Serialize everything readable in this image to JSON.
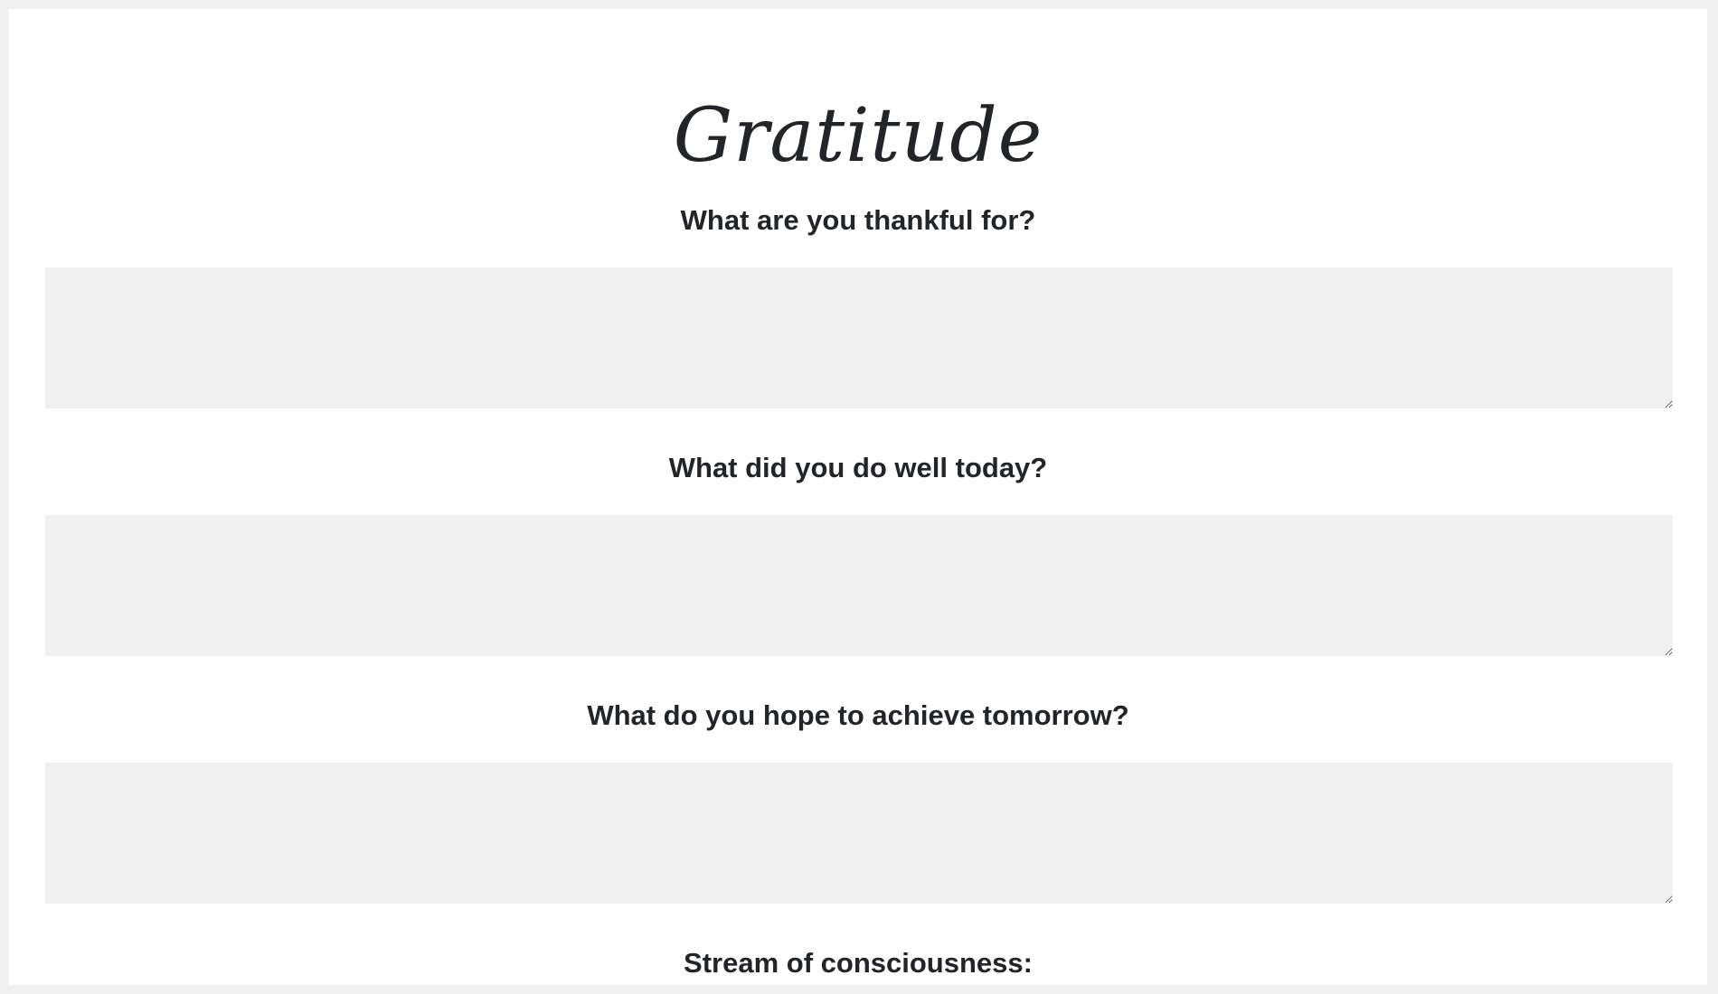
{
  "page": {
    "title": "Gratitude"
  },
  "questions": [
    {
      "label": "What are you thankful for?",
      "value": ""
    },
    {
      "label": "What did you do well today?",
      "value": ""
    },
    {
      "label": "What do you hope to achieve tomorrow?",
      "value": ""
    },
    {
      "label": "Stream of consciousness:",
      "value": ""
    }
  ]
}
